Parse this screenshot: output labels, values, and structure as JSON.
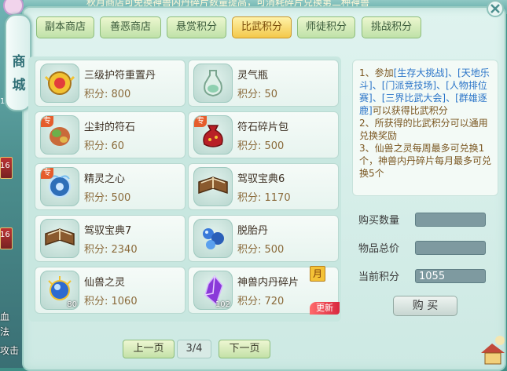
{
  "top_ticker": "秋月商店可免换神兽内丹碎片数量提高，可消耗碎片兑换第二种神兽",
  "side_title": [
    "商",
    "城"
  ],
  "side_numbers": [
    "16",
    "16",
    "1"
  ],
  "side_texts": [
    "血",
    "法",
    "攻击"
  ],
  "tabs": [
    {
      "label": "副本商店",
      "active": false
    },
    {
      "label": "善恶商店",
      "active": false
    },
    {
      "label": "悬赏积分",
      "active": false
    },
    {
      "label": "比武积分",
      "active": true
    },
    {
      "label": "师徒积分",
      "active": false
    },
    {
      "label": "挑战积分",
      "active": false
    }
  ],
  "items": [
    {
      "name": "三级护符重置丹",
      "price": "积分: 800",
      "icon": "gold-charm-icon",
      "zhuan": false,
      "qty": ""
    },
    {
      "name": "灵气瓶",
      "price": "积分: 50",
      "icon": "spirit-bottle-icon",
      "zhuan": false,
      "qty": ""
    },
    {
      "name": "尘封的符石",
      "price": "积分: 60",
      "icon": "rune-stone-icon",
      "zhuan": true,
      "qty": ""
    },
    {
      "name": "符石碎片包",
      "price": "积分: 500",
      "icon": "rune-bag-icon",
      "zhuan": true,
      "qty": ""
    },
    {
      "name": "精灵之心",
      "price": "积分: 500",
      "icon": "spirit-heart-icon",
      "zhuan": true,
      "qty": ""
    },
    {
      "name": "驾驭宝典6",
      "price": "积分: 1170",
      "icon": "book-icon",
      "zhuan": false,
      "qty": ""
    },
    {
      "name": "驾驭宝典7",
      "price": "积分: 2340",
      "icon": "book-icon",
      "zhuan": false,
      "qty": ""
    },
    {
      "name": "脱胎丹",
      "price": "积分: 500",
      "icon": "blue-pill-icon",
      "zhuan": false,
      "qty": ""
    },
    {
      "name": "仙兽之灵",
      "price": "积分: 1060",
      "icon": "spirit-orb-icon",
      "zhuan": false,
      "qty": "80"
    },
    {
      "name": "神兽内丹碎片",
      "price": "积分: 720",
      "icon": "crystal-shard-icon",
      "zhuan": false,
      "qty": "102",
      "month_tag": "月",
      "new_tag": "更新"
    }
  ],
  "pager": {
    "prev": "上一页",
    "page": "3/4",
    "next": "下一页"
  },
  "rules": {
    "line1_prefix": "1、参加",
    "links": [
      "[生存大挑战]",
      "、[天地乐斗]",
      "、[门派竞技场]",
      "、[人物排位赛]",
      "、[三界比武大会]",
      "、[群雄逐鹿]"
    ],
    "line1_suffix": "可以获得比武积分",
    "line2": "2、所获得的比武积分可以通用兑换奖励",
    "line3": "3、仙兽之灵每周最多可兑换1个，神兽内丹碎片每月最多可兑换5个"
  },
  "form": {
    "qty_label": "购买数量",
    "qty_value": "",
    "total_label": "物品总价",
    "total_value": "",
    "points_label": "当前积分",
    "points_value": "1055",
    "buy_label": "购 买"
  },
  "colors": {
    "active_tab": "#f3c84a",
    "tab": "#bfe1a8",
    "panel": "#dff3ef",
    "link": "#2a74c8",
    "rules_text": "#7a5620"
  }
}
